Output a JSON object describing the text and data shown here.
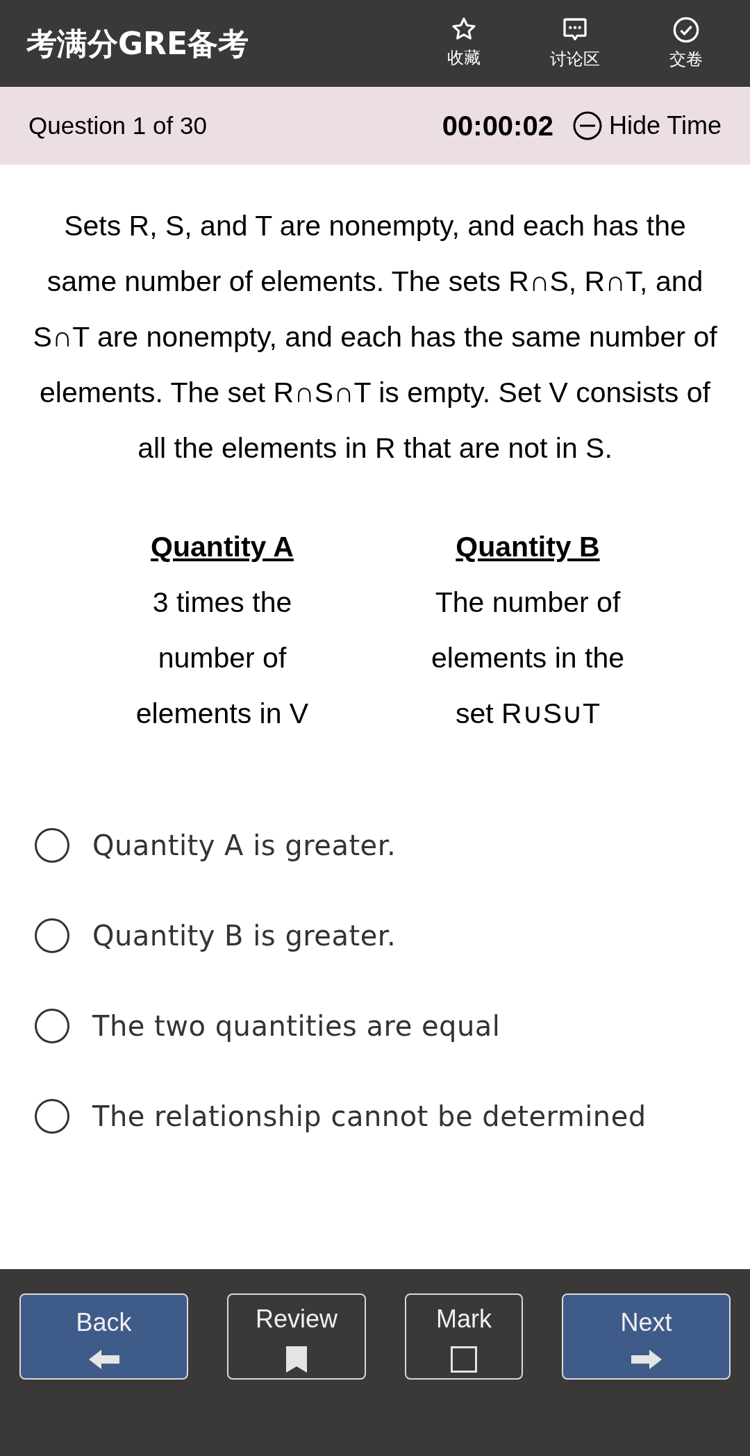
{
  "header": {
    "title": "考满分GRE备考",
    "actions": [
      {
        "kind": "star",
        "label": "收藏"
      },
      {
        "kind": "chat",
        "label": "讨论区"
      },
      {
        "kind": "check",
        "label": "交卷"
      }
    ]
  },
  "status": {
    "progress": "Question 1 of 30",
    "timer": "00:00:02",
    "toggle": "Hide Time"
  },
  "question": "Sets R, S, and T are nonempty, and each has the same number of elements. The sets R∩S, R∩T, and S∩T are nonempty, and each has the same number of elements. The set R∩S∩T is empty. Set V consists of all the elements in R that are not in S.",
  "quantities": [
    {
      "heading": "Quantity A",
      "text": "3 times the number of elements in V"
    },
    {
      "heading": "Quantity B",
      "text": "The number of elements in the set R∪S∪T"
    }
  ],
  "options": [
    {
      "text": "Quantity A is greater.",
      "selected": false
    },
    {
      "text": "Quantity B is greater.",
      "selected": false
    },
    {
      "text": "The two quantities are equal",
      "selected": false
    },
    {
      "text": "The relationship cannot be determined",
      "selected": false
    }
  ],
  "footer": [
    {
      "kind": "back",
      "label": "Back"
    },
    {
      "kind": "review",
      "label": "Review"
    },
    {
      "kind": "mark",
      "label": "Mark",
      "checked": false
    },
    {
      "kind": "next",
      "label": "Next"
    }
  ]
}
